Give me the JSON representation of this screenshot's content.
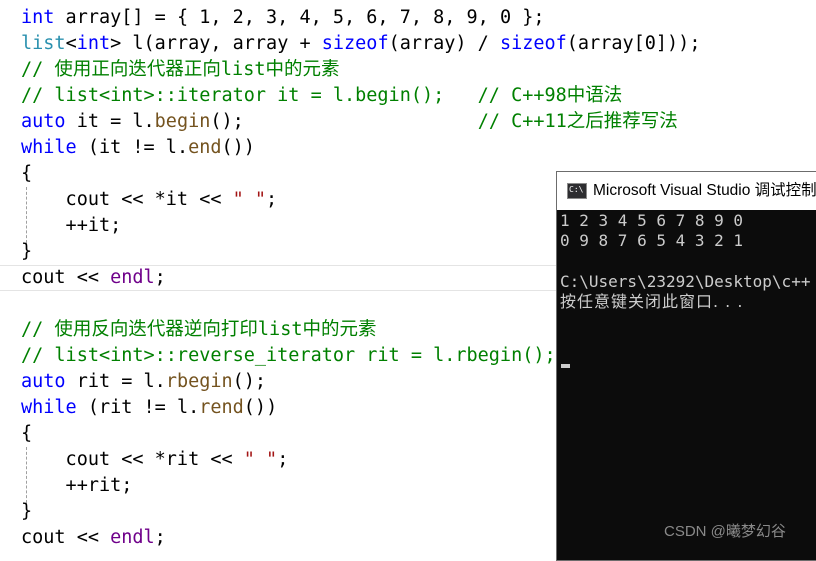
{
  "editor": {
    "lines": [
      [
        {
          "t": "int",
          "c": "kw"
        },
        {
          "t": " array[] = { "
        },
        {
          "t": "1, 2, 3, 4, 5, 6, 7, 8, 9, 0"
        },
        {
          "t": " };"
        }
      ],
      [
        {
          "t": "list",
          "c": "ty"
        },
        {
          "t": "<"
        },
        {
          "t": "int",
          "c": "kw"
        },
        {
          "t": "> l(array, array + "
        },
        {
          "t": "sizeof",
          "c": "kw"
        },
        {
          "t": "(array) / "
        },
        {
          "t": "sizeof",
          "c": "kw"
        },
        {
          "t": "(array[0]));"
        }
      ],
      [
        {
          "t": "// 使用正向迭代器正向list中的元素",
          "c": "cm"
        }
      ],
      [
        {
          "t": "// list<int>::iterator it = l.begin();   // C++98中语法",
          "c": "cm"
        }
      ],
      [
        {
          "t": "auto",
          "c": "kw"
        },
        {
          "t": " it = l."
        },
        {
          "t": "begin",
          "c": "fn"
        },
        {
          "t": "();                     "
        },
        {
          "t": "// C++11之后推荐写法",
          "c": "cm"
        }
      ],
      [
        {
          "t": "while",
          "c": "kw"
        },
        {
          "t": " (it != l."
        },
        {
          "t": "end",
          "c": "fn"
        },
        {
          "t": "())"
        }
      ],
      [
        {
          "t": "{"
        }
      ],
      [
        {
          "t": "    cout << *it << "
        },
        {
          "t": "\" \"",
          "c": "str"
        },
        {
          "t": ";"
        }
      ],
      [
        {
          "t": "    ++it;"
        }
      ],
      [
        {
          "t": "}"
        }
      ],
      [
        {
          "t": "cout << "
        },
        {
          "t": "endl",
          "c": "mac"
        },
        {
          "t": ";"
        }
      ],
      [
        {
          "t": ""
        }
      ],
      [
        {
          "t": "// 使用反向迭代器逆向打印list中的元素",
          "c": "cm"
        }
      ],
      [
        {
          "t": "// list<int>::reverse_iterator rit = l.rbegin();",
          "c": "cm"
        }
      ],
      [
        {
          "t": "auto",
          "c": "kw"
        },
        {
          "t": " rit = l."
        },
        {
          "t": "rbegin",
          "c": "fn"
        },
        {
          "t": "();"
        }
      ],
      [
        {
          "t": "while",
          "c": "kw"
        },
        {
          "t": " (rit != l."
        },
        {
          "t": "rend",
          "c": "fn"
        },
        {
          "t": "())"
        }
      ],
      [
        {
          "t": "{"
        }
      ],
      [
        {
          "t": "    cout << *rit << "
        },
        {
          "t": "\" \"",
          "c": "str"
        },
        {
          "t": ";"
        }
      ],
      [
        {
          "t": "    ++rit;"
        }
      ],
      [
        {
          "t": "}"
        }
      ],
      [
        {
          "t": "cout << "
        },
        {
          "t": "endl",
          "c": "mac"
        },
        {
          "t": ";"
        }
      ]
    ]
  },
  "console": {
    "title": "Microsoft Visual Studio 调试控制台",
    "icon": "console-app-icon",
    "output_line1": "1 2 3 4 5 6 7 8 9 0",
    "output_line2": "0 9 8 7 6 5 4 3 2 1",
    "path_line": "C:\\Users\\23292\\Desktop\\c++",
    "prompt_line": "按任意键关闭此窗口. . ."
  },
  "watermark": "CSDN @曦梦幻谷",
  "colors": {
    "keyword": "#0000ff",
    "type": "#2b91af",
    "function": "#74531f",
    "string": "#a31515",
    "comment": "#008000",
    "macro": "#6f008a",
    "console_bg": "#0c0c0c",
    "console_text": "#cccccc"
  }
}
